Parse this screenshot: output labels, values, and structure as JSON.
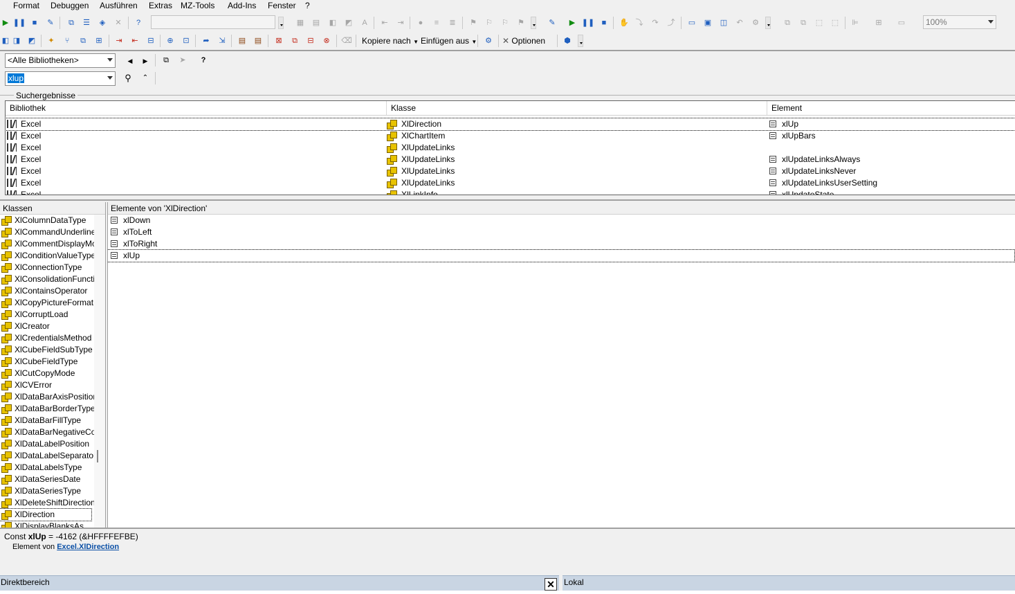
{
  "menu": [
    "Format",
    "Debuggen",
    "Ausführen",
    "Extras",
    "MZ-Tools",
    "Add-Ins",
    "Fenster",
    "?"
  ],
  "toolbar1": {
    "zoom_value": "100%"
  },
  "toolbar2": {
    "copy_to_label": "Kopiere nach",
    "insert_from_label": "Einfügen aus",
    "options_label": "Optionen"
  },
  "browser": {
    "library_select": "<Alle Bibliotheken>",
    "search_value": "xlup"
  },
  "search_results": {
    "title": "Suchergebnisse",
    "columns": [
      "Bibliothek",
      "Klasse",
      "Element"
    ],
    "rows": [
      {
        "library": "Excel",
        "class": "XlDirection",
        "element": "xlUp"
      },
      {
        "library": "Excel",
        "class": "XlChartItem",
        "element": "xlUpBars"
      },
      {
        "library": "Excel",
        "class": "XlUpdateLinks",
        "element": ""
      },
      {
        "library": "Excel",
        "class": "XlUpdateLinks",
        "element": "xlUpdateLinksAlways"
      },
      {
        "library": "Excel",
        "class": "XlUpdateLinks",
        "element": "xlUpdateLinksNever"
      },
      {
        "library": "Excel",
        "class": "XlUpdateLinks",
        "element": "xlUpdateLinksUserSetting"
      },
      {
        "library": "Excel",
        "class": "XlLinkInfo",
        "element": "xlUpdateState"
      }
    ]
  },
  "classes": {
    "header": "Klassen",
    "items": [
      "XlColumnDataType",
      "XlCommandUnderlines",
      "XlCommentDisplayMode",
      "XlConditionValueTypes",
      "XlConnectionType",
      "XlConsolidationFunction",
      "XlContainsOperator",
      "XlCopyPictureFormat",
      "XlCorruptLoad",
      "XlCreator",
      "XlCredentialsMethod",
      "XlCubeFieldSubType",
      "XlCubeFieldType",
      "XlCutCopyMode",
      "XlCVError",
      "XlDataBarAxisPosition",
      "XlDataBarBorderType",
      "XlDataBarFillType",
      "XlDataBarNegativeColor",
      "XlDataLabelPosition",
      "XlDataLabelSeparator",
      "XlDataLabelsType",
      "XlDataSeriesDate",
      "XlDataSeriesType",
      "XlDeleteShiftDirection",
      "XlDirection",
      "XlDisplayBlanksAs"
    ],
    "selected": "XlDirection"
  },
  "members": {
    "header": "Elemente von 'XlDirection'",
    "items": [
      "xlDown",
      "xlToLeft",
      "xlToRight",
      "xlUp"
    ],
    "selected": "xlUp"
  },
  "details": {
    "const_prefix": "Const ",
    "const_name": "xlUp",
    "const_value": " = -4162 (&HFFFFEFBE)",
    "member_of_prefix": "Element von ",
    "member_of_library": "Excel",
    "member_of_dot": ".",
    "member_of_class": "XlDirection"
  },
  "panels": {
    "immediate": "Direktbereich",
    "locals": "Lokal"
  }
}
